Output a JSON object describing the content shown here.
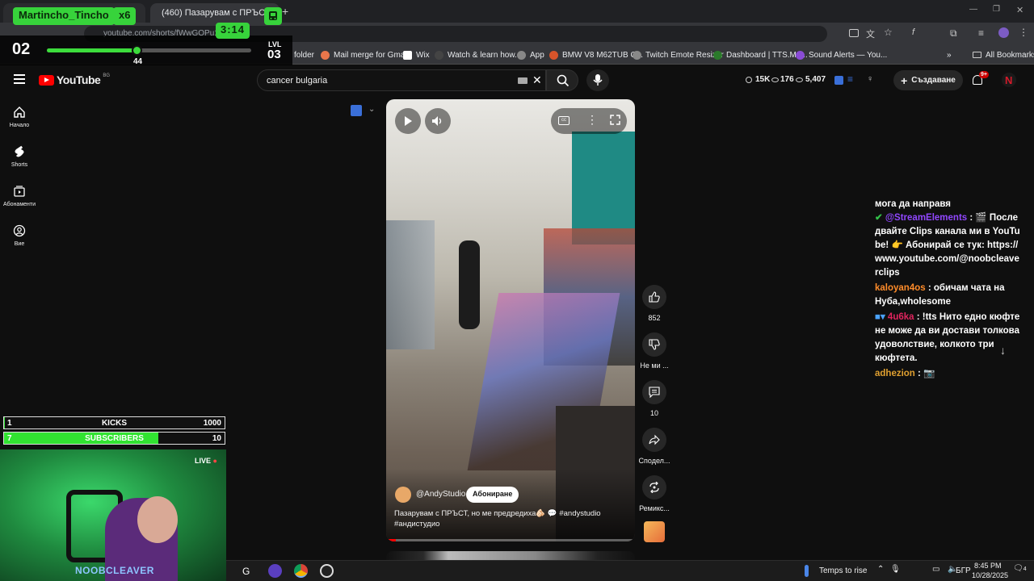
{
  "browser": {
    "tabs": [
      {
        "label": "(460) Пазарувам с ПРЪСТ, но м",
        "active": true
      }
    ],
    "url": "youtube.com/shorts/fWwGOPu1V4A",
    "bookmarks": [
      {
        "label": "folder",
        "icon": "folder-icon"
      },
      {
        "label": "Mail merge for Gma...",
        "icon": "mail-icon"
      },
      {
        "label": "Wix",
        "icon": "wix-icon"
      },
      {
        "label": "Watch & learn how...",
        "icon": "video-icon"
      },
      {
        "label": "App",
        "icon": "globe-icon"
      },
      {
        "label": "BMW V8 M62TUB C...",
        "icon": "bmw-icon"
      },
      {
        "label": "Twitch Emote Resizer",
        "icon": "globe-icon"
      },
      {
        "label": "Dashboard | TTS.Mo...",
        "icon": "dashboard-icon"
      },
      {
        "label": "Sound Alerts — You...",
        "icon": "sound-icon"
      }
    ],
    "all_bookmarks": "All Bookmarks"
  },
  "overlay": {
    "name": "Martincho_Tincho",
    "multiplier": "x6",
    "timer": "3:14",
    "level_left": "02",
    "xp": "44",
    "xp_progress": 0.44,
    "lvl_label": "LVL",
    "lvl_value": "03",
    "kicks": {
      "num": "1",
      "label": "KICKS",
      "goal": "1000",
      "progress": 0.001
    },
    "subs": {
      "num": "7",
      "label": "SUBSCRIBERS",
      "goal": "10",
      "progress": 0.7
    },
    "live": "LIVE",
    "streamer": "NOOBCLEAVER"
  },
  "youtube": {
    "logo": "YouTube",
    "region": "BG",
    "search_value": "cancer bulgaria",
    "stats": [
      {
        "icon": "clock-icon",
        "value": "15K"
      },
      {
        "icon": "eye-icon",
        "value": "176"
      },
      {
        "icon": "eye-icon",
        "value": "5,407"
      }
    ],
    "create_label": "Създаване",
    "notif_badge": "9+",
    "sidebar": [
      {
        "label": "Начало",
        "icon": "home-icon"
      },
      {
        "label": "Shorts",
        "icon": "shorts-icon"
      },
      {
        "label": "Абонаменти",
        "icon": "subscriptions-icon"
      },
      {
        "label": "Вие",
        "icon": "you-icon"
      }
    ],
    "short": {
      "channel": "@AndyStudio",
      "subscribe": "Абониране",
      "title": "Пазарувам с ПРЪСТ, но ме предредиха🫵🏻 💬 #andystudio #андистудио",
      "progress": 0.04
    },
    "actions": [
      {
        "icon": "like-icon",
        "label": "852"
      },
      {
        "icon": "dislike-icon",
        "label": "Не ми ..."
      },
      {
        "icon": "comment-icon",
        "label": "10"
      },
      {
        "icon": "share-icon",
        "label": "Сподел..."
      },
      {
        "icon": "remix-icon",
        "label": "Ремикс..."
      }
    ]
  },
  "chat": [
    {
      "user": "",
      "text": "мога да направя",
      "color": "#ffffff"
    },
    {
      "user": "@StreamElements",
      "text": ": 🎬 Последвайте Clips канала ми в YouTube! 👉 Абонирай се тук: https://www.youtube.com/@noobcleaverclips",
      "color": "#9147ff"
    },
    {
      "user": "kaloyan4os",
      "text": ": обичам чата на Нуба,wholesome",
      "color": "#ff8c2a"
    },
    {
      "user": "4u6ka",
      "text": ": !tts Нито едно кюфте не може да ви достави толкова удоволствие, колкото три кюфтета.",
      "color": "#e0245e"
    },
    {
      "user": "adhezion",
      "text": ": 📷",
      "color": "#e0a030"
    }
  ],
  "taskbar": {
    "weather": "Temps to rise",
    "lang": "БГР",
    "time": "8:45 PM",
    "date": "10/28/2025",
    "notif_count": "4"
  }
}
